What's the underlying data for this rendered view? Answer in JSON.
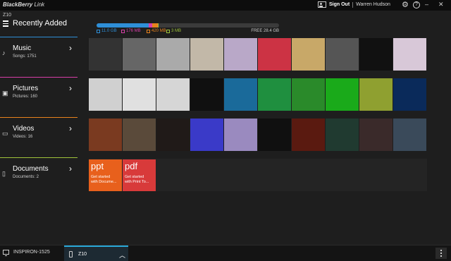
{
  "app": {
    "brand_name": "BlackBerry",
    "brand_suffix": " Link"
  },
  "topbar": {
    "sign_out_label": "Sign Out",
    "user_name": "Warren Hudson",
    "help_label": "?",
    "minimize_label": "–",
    "close_label": "✕"
  },
  "device": {
    "id": "Z10"
  },
  "section": {
    "title": "Recently Added"
  },
  "storage": {
    "segments": [
      {
        "label": "11.0 GB",
        "fraction": 0.285,
        "color": "#2e8fd8"
      },
      {
        "label": "176 MB",
        "fraction": 0.02,
        "color": "#d83fa8"
      },
      {
        "label": "420 MB",
        "fraction": 0.03,
        "color": "#e8821c"
      },
      {
        "label": "3 MB",
        "fraction": 0.005,
        "color": "#9fc43a"
      }
    ],
    "free_label": "FREE 28.4 GB"
  },
  "categories": [
    {
      "name": "Music",
      "count": "Songs: 1751",
      "icon": "music-note-icon",
      "color": "#2e8fd8"
    },
    {
      "name": "Pictures",
      "count": "Pictures: 160",
      "icon": "picture-icon",
      "color": "#d83fa8"
    },
    {
      "name": "Videos",
      "count": "Videos: 16",
      "icon": "video-icon",
      "color": "#e8821c"
    },
    {
      "name": "Documents",
      "count": "Documents: 2",
      "icon": "document-icon",
      "color": "#9fc43a"
    }
  ],
  "music_tiles": [
    "#333333",
    "#666666",
    "#aaaaaa",
    "#c2b8a8",
    "#b9a8c8",
    "#cc3344",
    "#c8a868",
    "#555555",
    "#111111",
    "#d8c8d8"
  ],
  "picture_tiles": [
    "#d0d0d0",
    "#e0e0e0",
    "#d6d6d6",
    "#101010",
    "#1a6a9a",
    "#1f8f3f",
    "#2a8a2a",
    "#1aaa1a",
    "#8fa030",
    "#0a2a5a"
  ],
  "video_tiles": [
    "#7a3a20",
    "#5a4a3a",
    "#201a18",
    "#3a3ac8",
    "#9a8abf",
    "#101010",
    "#5a1a10",
    "#203a30",
    "#3a2a2a",
    "#3a4a5a"
  ],
  "documents": [
    {
      "ext": "ppt",
      "desc_line1": "Get started",
      "desc_line2": "with Docume...",
      "color": "#e8601c"
    },
    {
      "ext": "pdf",
      "desc_line1": "Get started",
      "desc_line2": "with Print To...",
      "color": "#d83a3a"
    }
  ],
  "bottombar": {
    "pc_name": "INSPIRON-1525",
    "device_tab": "Z10"
  }
}
